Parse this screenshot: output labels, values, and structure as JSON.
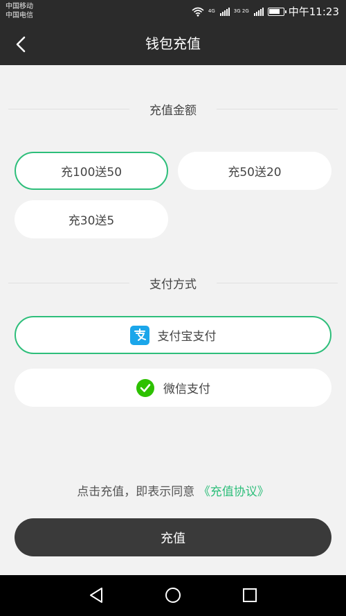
{
  "status_bar": {
    "carrier_1": "中国移动",
    "carrier_2": "中国电信",
    "network_1": "4G",
    "network_2": "3G 2G",
    "time": "中午11:23"
  },
  "nav": {
    "title": "钱包充值",
    "back_icon": "chevron-left-icon"
  },
  "amount_section": {
    "title": "充值金额",
    "options": [
      {
        "label": "充100送50",
        "selected": true
      },
      {
        "label": "充50送20",
        "selected": false
      },
      {
        "label": "充30送5",
        "selected": false
      }
    ]
  },
  "payment_section": {
    "title": "支付方式",
    "options": [
      {
        "label": "支付宝支付",
        "icon": "alipay-icon",
        "selected": true
      },
      {
        "label": "微信支付",
        "icon": "wechat-icon",
        "selected": false
      }
    ]
  },
  "agreement": {
    "text": "点击充值，即表示同意",
    "link": "《充值协议》"
  },
  "submit": {
    "label": "充值"
  },
  "colors": {
    "accent": "#2dbe7a",
    "header": "#2b2b2b",
    "background": "#f2f2f2",
    "button": "#3a3a3a",
    "alipay": "#1ba6ea",
    "wechat": "#2dc100"
  }
}
